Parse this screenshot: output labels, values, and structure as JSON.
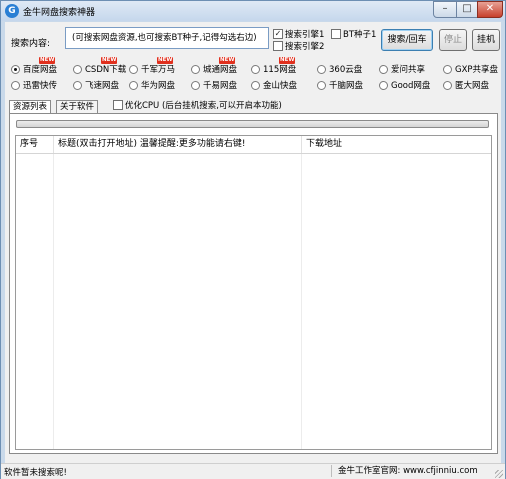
{
  "window": {
    "title": "金牛网盘搜索神器",
    "app_icon_glyph": "G"
  },
  "search": {
    "label": "搜索内容:",
    "value": "(可搜索网盘资源,也可搜索BT种子,记得勾选右边)",
    "engine1_label": "搜索引擎1",
    "engine1_checked": true,
    "engine2_label": "搜索引擎2",
    "engine2_checked": false,
    "bt_label": "BT种子1",
    "bt_checked": false
  },
  "buttons": {
    "search": "搜索/回车",
    "stop": "停止",
    "hang": "挂机"
  },
  "sources": [
    {
      "label": "百度网盘",
      "selected": true,
      "new": true
    },
    {
      "label": "CSDN下载",
      "selected": false,
      "new": true
    },
    {
      "label": "千军万马",
      "selected": false,
      "new": true
    },
    {
      "label": "城通网盘",
      "selected": false,
      "new": true
    },
    {
      "label": "115网盘",
      "selected": false,
      "new": true
    },
    {
      "label": "360云盘",
      "selected": false,
      "new": false
    },
    {
      "label": "爱问共享",
      "selected": false,
      "new": false
    },
    {
      "label": "GXP共享盘",
      "selected": false,
      "new": false
    },
    {
      "label": "迅雷快传",
      "selected": false,
      "new": false
    },
    {
      "label": "飞速网盘",
      "selected": false,
      "new": false
    },
    {
      "label": "华为网盘",
      "selected": false,
      "new": false
    },
    {
      "label": "千易网盘",
      "selected": false,
      "new": false
    },
    {
      "label": "金山快盘",
      "selected": false,
      "new": false
    },
    {
      "label": "千脑网盘",
      "selected": false,
      "new": false
    },
    {
      "label": "Good网盘",
      "selected": false,
      "new": false
    },
    {
      "label": "匿大网盘",
      "selected": false,
      "new": false
    }
  ],
  "new_badge_text": "NEW",
  "tabs": [
    {
      "label": "资源列表",
      "active": true
    },
    {
      "label": "关于软件",
      "active": false
    }
  ],
  "optimize": {
    "label": "优化CPU (后台挂机搜索,可以开启本功能)",
    "checked": false
  },
  "table": {
    "columns": [
      "序号",
      "标题(双击打开地址) 温馨提醒:更多功能请右键!",
      "下载地址"
    ],
    "rows": []
  },
  "status": {
    "left": "软件暂未搜索呢!",
    "right": "金牛工作室官网: www.cfjinniu.com"
  },
  "colors": {
    "window_border": "#6d8fb3",
    "close_button": "#c7402c",
    "new_badge": "#e0301e"
  }
}
